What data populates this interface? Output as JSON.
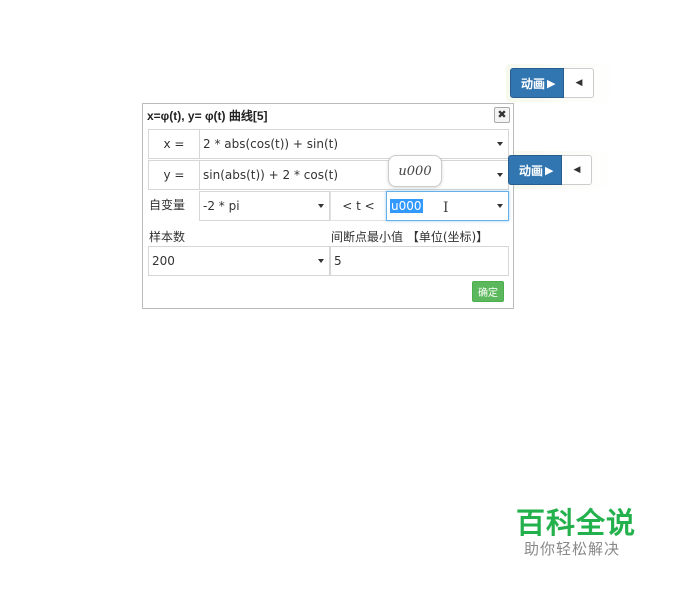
{
  "toolbar_top": {
    "animate_label": "动画",
    "play_glyph": "▶",
    "back_glyph": "◀"
  },
  "toolbar_mid": {
    "animate_label": "动画",
    "play_glyph": "▶",
    "back_glyph": "◀"
  },
  "dialog": {
    "title": "x=φ(t), y= φ(t) 曲线[5]",
    "close_glyph": "✖",
    "x_label": "x =",
    "x_value": "2 * abs(cos(t)) + sin(t)",
    "y_label": "y =",
    "y_value": "sin(abs(t)) + 2 * cos(t)",
    "var_label": "自变量",
    "t_min": "-2 * pi",
    "t_range_label": "< t <",
    "t_max": "u000",
    "samples_label": "样本数",
    "breakpoint_label": "间断点最小值 【单位(坐标)】",
    "samples_value": "200",
    "breakpoint_value": "5",
    "ok_label": "确定"
  },
  "tooltip": {
    "text": "u000"
  },
  "watermark": {
    "title": "百科全说",
    "subtitle": "助你轻松解决"
  }
}
